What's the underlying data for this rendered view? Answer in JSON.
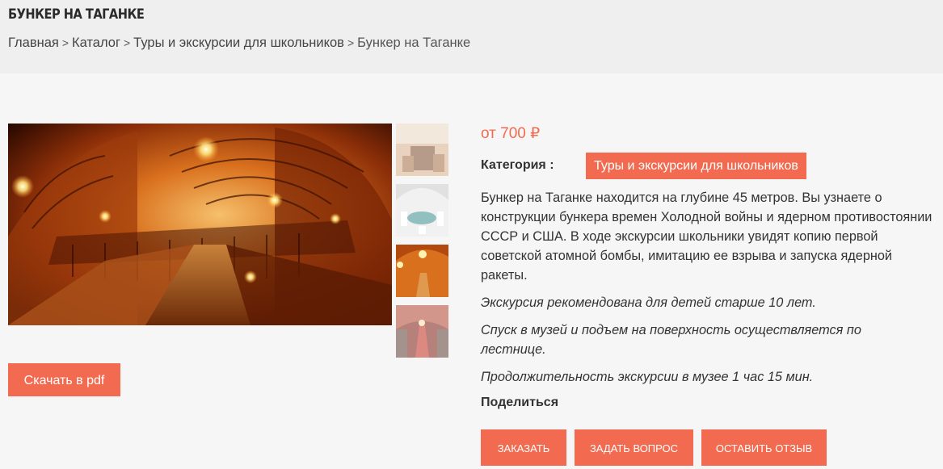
{
  "header": {
    "title": "Бункер на Таганке",
    "breadcrumb": {
      "items": [
        "Главная",
        "Каталог",
        "Туры и экскурсии для школьников"
      ],
      "current": "Бункер на Таганке",
      "separator": ">"
    }
  },
  "gallery": {
    "main_image": "bunker-tunnel-photo",
    "thumbnails": [
      "bunker-room-photo",
      "bunker-hall-table-photo",
      "bunker-tunnel-photo",
      "bunker-corridor-photo"
    ],
    "active_index": 2
  },
  "download": {
    "label": "Скачать в pdf"
  },
  "product": {
    "price": "от 700 ₽",
    "category_label": "Категория :",
    "category_value": "Туры и экскурсии для школьников",
    "description": "Бункер на Таганке находится на глубине 45 метров. Вы узнаете о конструкции бункера времен Холодной войны и ядерном противостоянии СССР и США. В ходе экскурсии школьники увидят копию первой советской атомной бомбы, имитацию ее взрыва и запуска ядерной ракеты.",
    "notes": [
      "Экскурсия рекомендована для детей старше 10 лет.",
      "Спуск в музей и подъем на поверхность осуществляется по лестнице.",
      "Продолжительность экскурсии в музее 1 час 15 мин."
    ],
    "share_label": "Поделиться"
  },
  "actions": {
    "order": "Заказать",
    "ask": "Задать вопрос",
    "review": "Оставить отзыв"
  },
  "colors": {
    "accent": "#f26b50",
    "header_bg": "#efefef",
    "page_bg": "#f6f6f6"
  }
}
